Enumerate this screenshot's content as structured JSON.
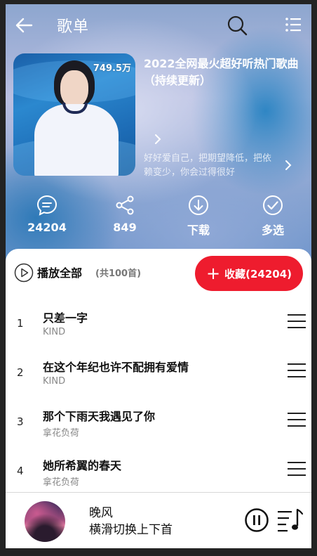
{
  "header": {
    "title": "歌单"
  },
  "playlist": {
    "play_count": "749.5万",
    "title": "2022全网最火超好听热门歌曲（持续更新）",
    "description": "好好爱自己，把期望降低，把依赖变少，你会过得很好"
  },
  "actions": [
    {
      "label": "24204",
      "icon": "comment-icon"
    },
    {
      "label": "849",
      "icon": "share-icon"
    },
    {
      "label": "下载",
      "icon": "download-icon"
    },
    {
      "label": "多选",
      "icon": "check-circle-icon"
    }
  ],
  "list_header": {
    "play_all_label": "播放全部",
    "count_label": "(共100首)",
    "collect_label": "收藏(24204)",
    "collect_color": "#ee1c2e"
  },
  "songs": [
    {
      "index": "1",
      "name": "只差一字",
      "artist": "KIND"
    },
    {
      "index": "2",
      "name": "在这个年纪也许不配拥有爱情",
      "artist": "KIND"
    },
    {
      "index": "3",
      "name": "那个下雨天我遇见了你",
      "artist": "拿花负荷"
    },
    {
      "index": "4",
      "name": "她所希翼的春天",
      "artist": "拿花负荷"
    }
  ],
  "player": {
    "track_name": "晚风",
    "hint": "横滑切换上下首"
  }
}
